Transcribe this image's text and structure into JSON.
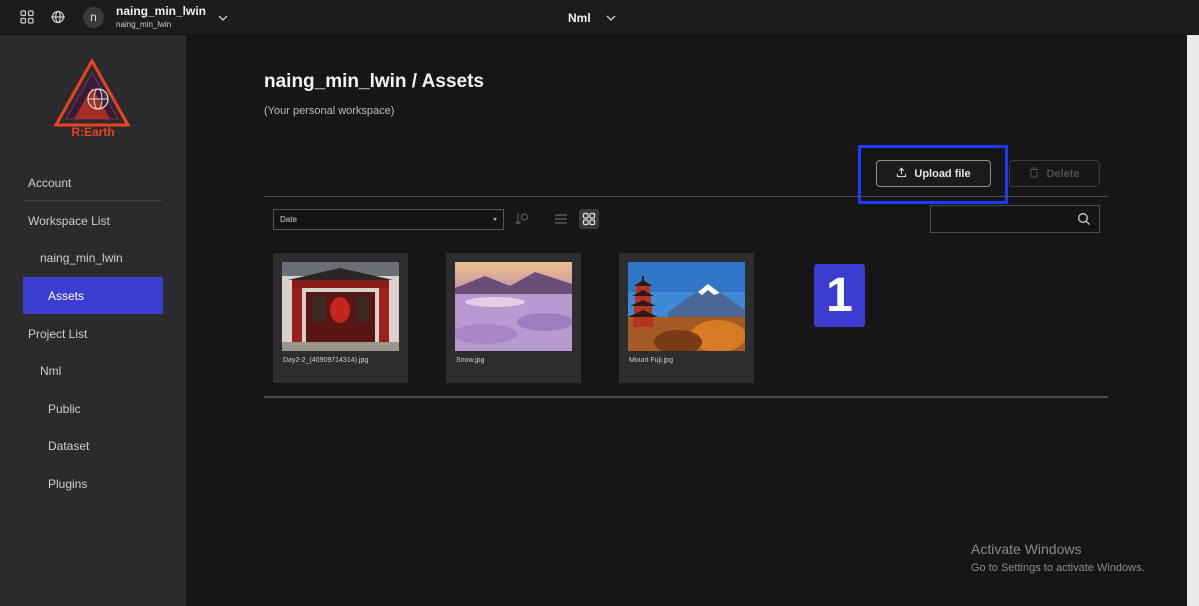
{
  "topbar": {
    "avatar_initial": "n",
    "user_name": "naing_min_lwin",
    "user_sub": "naing_min_lwin",
    "project_name": "Nml"
  },
  "sidebar": {
    "logo_text": "R:Earth",
    "items": [
      {
        "label": "Account"
      },
      {
        "label": "Workspace List"
      },
      {
        "label": "naing_min_lwin"
      },
      {
        "label": "Assets"
      },
      {
        "label": "Project List"
      },
      {
        "label": "Nml"
      },
      {
        "label": "Public"
      },
      {
        "label": "Dataset"
      },
      {
        "label": "Plugins"
      }
    ]
  },
  "main": {
    "title": "naing_min_lwin / Assets",
    "subtitle": "(Your personal workspace)",
    "upload_label": "Upload file",
    "delete_label": "Delete",
    "sort_value": "Date",
    "search_placeholder": "",
    "assets": [
      {
        "name": "Day2-2_(40909714314).jpg"
      },
      {
        "name": "Snow.jpg"
      },
      {
        "name": "Mount Fuji.jpg"
      }
    ],
    "step_number": "1"
  },
  "watermark": {
    "line1": "Activate Windows",
    "line2": "Go to Settings to activate Windows."
  },
  "colors": {
    "accent": "#3b3cd0",
    "highlight": "#1d3bff",
    "brand": "#e9431f"
  }
}
